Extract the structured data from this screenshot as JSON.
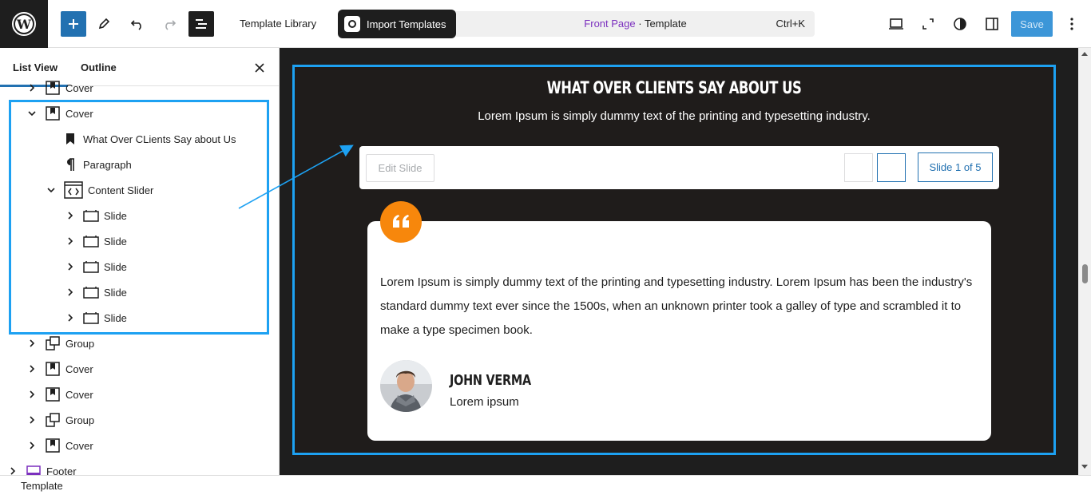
{
  "header": {
    "template_library": "Template Library",
    "import_templates": "Import Templates",
    "doc_title_link": "Front Page",
    "doc_title_rest": " · Template",
    "shortcut": "Ctrl+K",
    "save_label": "Save"
  },
  "sidebar": {
    "tabs": [
      "List View",
      "Outline"
    ],
    "tree": [
      {
        "label": "Cover",
        "icon": "cover-icon"
      },
      {
        "label": "Cover",
        "icon": "cover-icon"
      },
      {
        "label": "What Over CLients Say about Us",
        "icon": "bookmark-icon"
      },
      {
        "label": "Paragraph",
        "icon": "paragraph-icon"
      },
      {
        "label": "Content Slider",
        "icon": "slider-icon"
      },
      {
        "label": "Slide",
        "icon": "slide-icon"
      },
      {
        "label": "Slide",
        "icon": "slide-icon"
      },
      {
        "label": "Slide",
        "icon": "slide-icon"
      },
      {
        "label": "Slide",
        "icon": "slide-icon"
      },
      {
        "label": "Slide",
        "icon": "slide-icon"
      },
      {
        "label": "Group",
        "icon": "group-icon"
      },
      {
        "label": "Cover",
        "icon": "cover-icon"
      },
      {
        "label": "Cover",
        "icon": "cover-icon"
      },
      {
        "label": "Group",
        "icon": "group-icon"
      },
      {
        "label": "Cover",
        "icon": "cover-icon"
      },
      {
        "label": "Footer",
        "icon": "footer-icon"
      }
    ]
  },
  "canvas": {
    "heading": "WHAT OVER CLIENTS SAY ABOUT US",
    "paragraph": "Lorem Ipsum is simply dummy text of the printing and typesetting industry.",
    "edit_slide": "Edit Slide",
    "slide_counter": "Slide 1 of 5",
    "testimonial": "Lorem Ipsum is simply dummy text of the printing and typesetting industry. Lorem Ipsum has been the industry's standard dummy text ever since the 1500s, when an unknown printer took a galley of type and scrambled it to make a type specimen book.",
    "author_name": "JOHN VERMA",
    "author_role": "Lorem ipsum"
  },
  "status": {
    "breadcrumb": "Template"
  },
  "colors": {
    "accent": "#2271b1",
    "highlight": "#1da1f2",
    "quote": "#f7870c",
    "canvas_bg": "#1f1c1b"
  }
}
